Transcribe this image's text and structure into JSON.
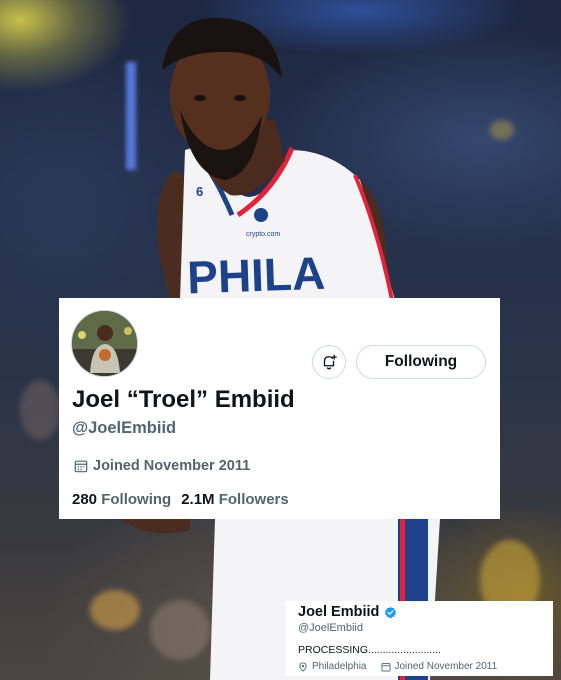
{
  "profile_card": {
    "display_name": "Joel “Troel” Embiid",
    "handle": "@JoelEmbiid",
    "follow_button_label": "Following",
    "joined": "Joined November 2011",
    "following_count": "280",
    "following_label": "Following",
    "followers_count": "2.1M",
    "followers_label": "Followers",
    "notify_icon": "bell-plus-icon",
    "calendar_icon": "calendar-icon"
  },
  "mini_card": {
    "display_name": "Joel Embiid",
    "handle": "@JoelEmbiid",
    "bio": "PROCESSING.........................",
    "location": "Philadelphia",
    "joined": "Joined November 2011",
    "verified_icon": "verified-badge-icon",
    "location_icon": "location-pin-icon",
    "calendar_icon": "calendar-icon"
  },
  "photo": {
    "jersey_text": "PHILA",
    "jersey_number": "6",
    "sponsor_text": "crypto.com"
  },
  "colors": {
    "text_primary": "#0f1419",
    "text_secondary": "#536471",
    "border": "#cfd9de",
    "verified_blue": "#1d9bf0",
    "jersey_blue": "#1d428a",
    "jersey_red": "#e0233a"
  }
}
